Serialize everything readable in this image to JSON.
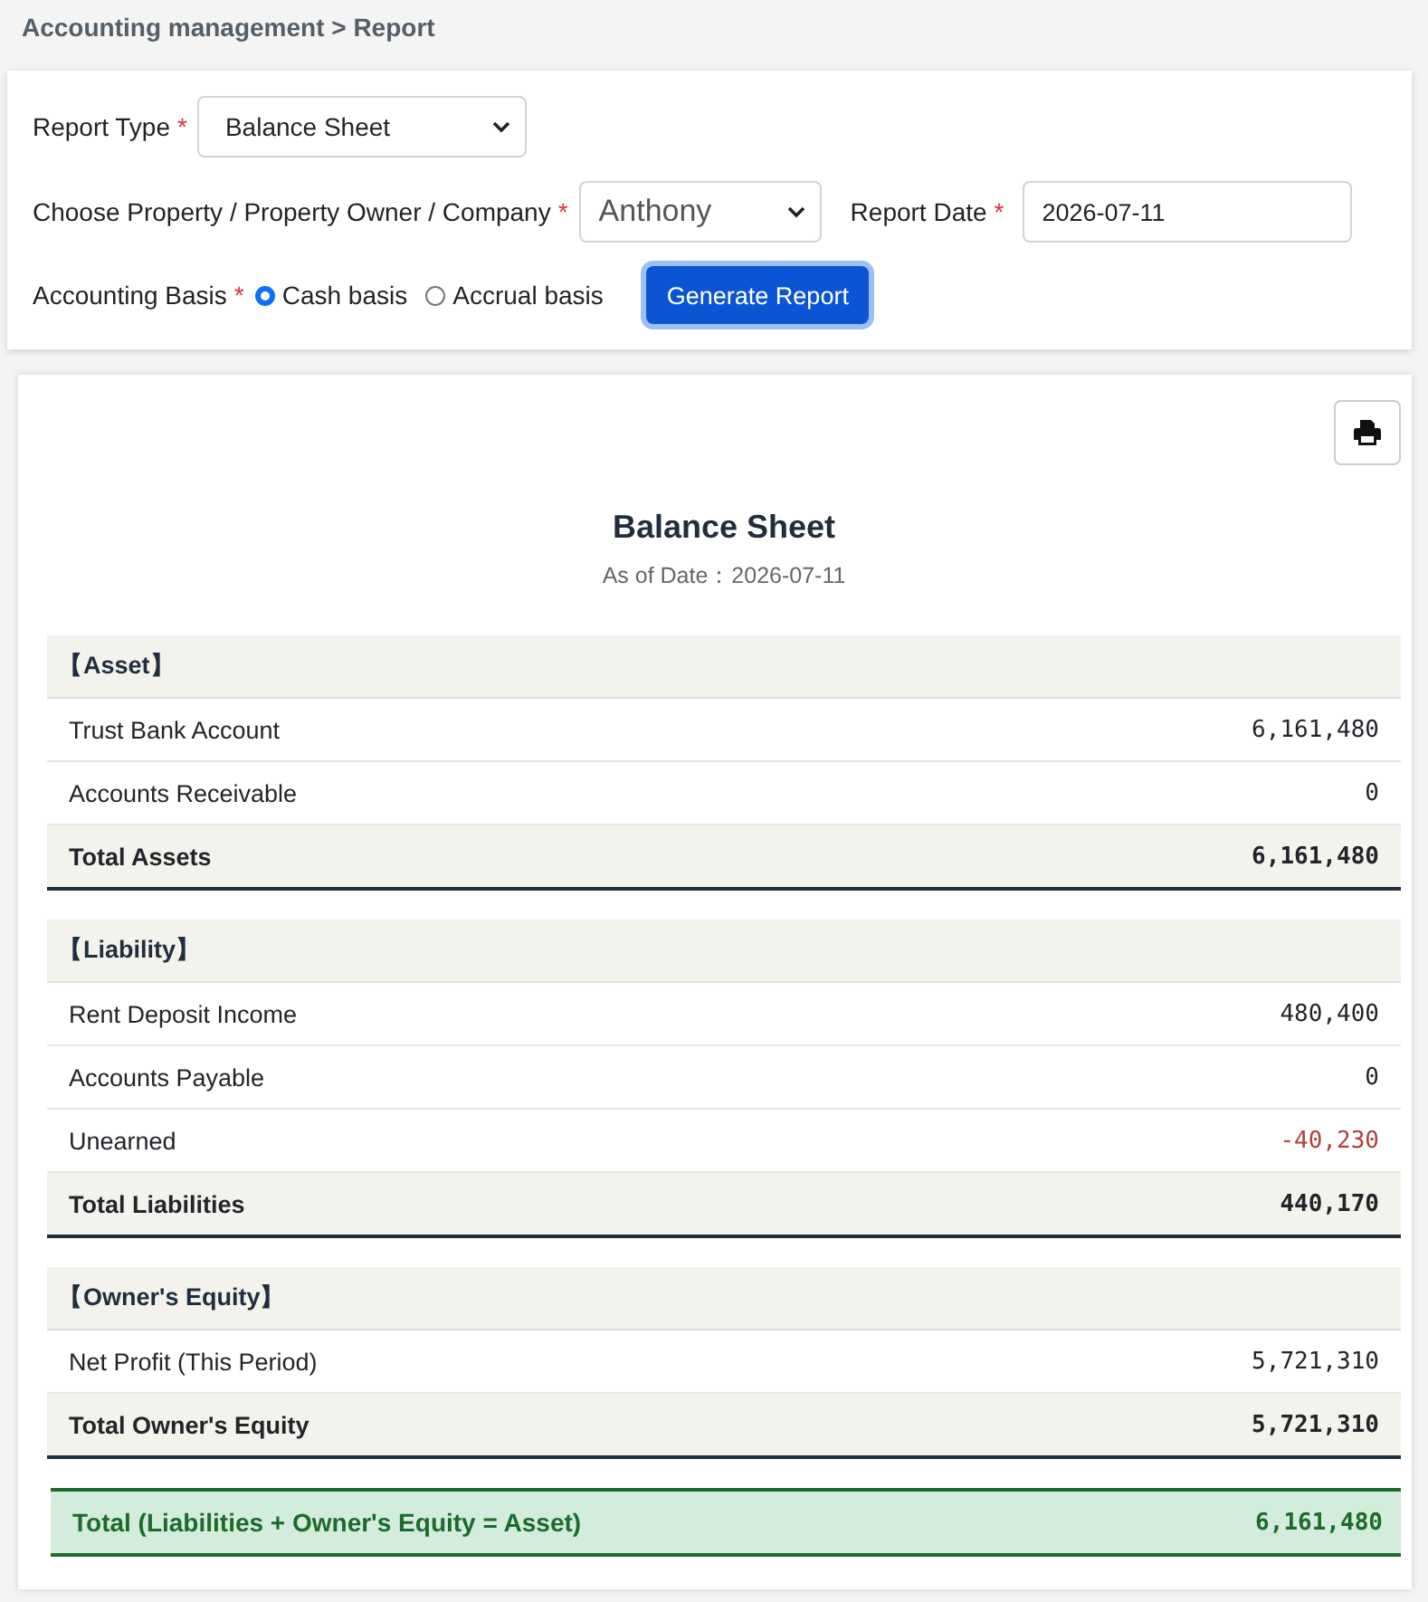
{
  "breadcrumb": "Accounting management > Report",
  "form": {
    "report_type": {
      "label": "Report Type",
      "required_mark": "*",
      "value": "Balance Sheet"
    },
    "owner": {
      "label": "Choose Property / Property Owner / Company",
      "required_mark": "*",
      "value": "Anthony"
    },
    "report_date": {
      "label": "Report Date",
      "required_mark": "*",
      "value": "2026-07-11"
    },
    "accounting_basis": {
      "label": "Accounting Basis",
      "required_mark": "*",
      "options": [
        {
          "label": "Cash basis",
          "selected": true
        },
        {
          "label": "Accrual basis",
          "selected": false
        }
      ]
    },
    "generate_button": "Generate Report"
  },
  "report": {
    "title": "Balance Sheet",
    "subtitle": "As of Date：2026-07-11",
    "sections": [
      {
        "heading": "【Asset】",
        "rows": [
          {
            "kind": "item",
            "label": "Trust Bank Account",
            "amount": "6,161,480",
            "negative": false
          },
          {
            "kind": "item",
            "label": "Accounts Receivable",
            "amount": "0",
            "negative": false
          },
          {
            "kind": "total",
            "label": "Total Assets",
            "amount": "6,161,480",
            "negative": false
          }
        ]
      },
      {
        "heading": "【Liability】",
        "rows": [
          {
            "kind": "item",
            "label": "Rent Deposit Income",
            "amount": "480,400",
            "negative": false
          },
          {
            "kind": "item",
            "label": "Accounts Payable",
            "amount": "0",
            "negative": false
          },
          {
            "kind": "item",
            "label": "Unearned",
            "amount": "-40,230",
            "negative": true
          },
          {
            "kind": "total",
            "label": "Total Liabilities",
            "amount": "440,170",
            "negative": false
          }
        ]
      },
      {
        "heading": "【Owner's Equity】",
        "rows": [
          {
            "kind": "item",
            "label": "Net Profit (This Period)",
            "amount": "5,721,310",
            "negative": false
          },
          {
            "kind": "total",
            "label": "Total Owner's Equity",
            "amount": "5,721,310",
            "negative": false
          }
        ]
      }
    ],
    "grand_total": {
      "label": "Total (Liabilities + Owner's Equity = Asset)",
      "amount": "6,161,480"
    }
  }
}
